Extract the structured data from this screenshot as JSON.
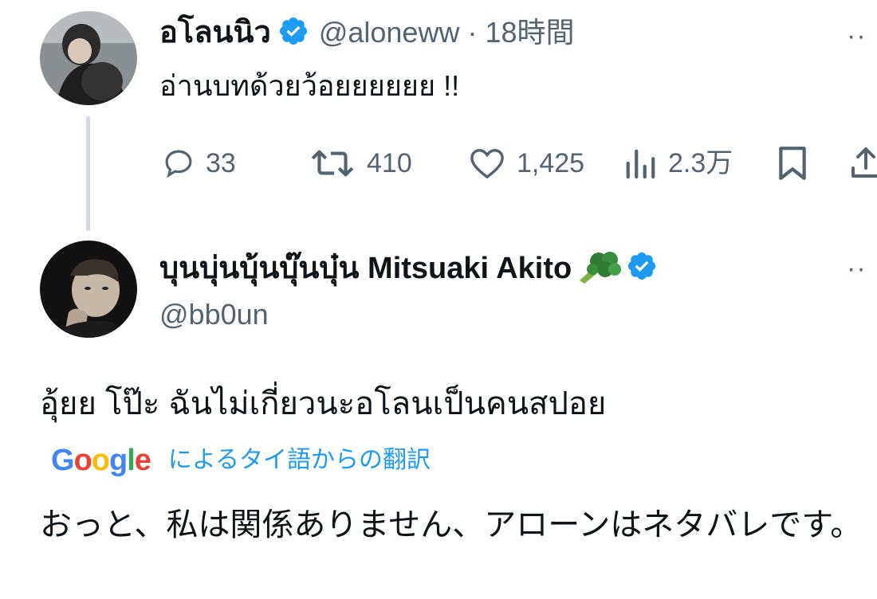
{
  "tweet1": {
    "display_name": "อโลนนิว",
    "handle": "@aloneww",
    "separator": "·",
    "time": "18時間",
    "text": "อ่านบทด้วยว้อยยยยยย !!",
    "actions": {
      "replies": "33",
      "reposts": "410",
      "likes": "1,425",
      "views": "2.3万"
    },
    "more": "··"
  },
  "tweet2": {
    "display_name": "บุนบุ่นบุ้นบุ๊นบุ๋น Mitsuaki Akito",
    "emoji": "🥦",
    "handle": "@bb0un",
    "text": "อุ้ยย โป๊ะ ฉันไม่เกี่ยวนะอโลนเป็นคนสปอย",
    "more": "··",
    "translation": {
      "provider_letters": [
        "G",
        "o",
        "o",
        "g",
        "l",
        "e"
      ],
      "provider_colors": [
        "#4285F4",
        "#EA4335",
        "#FBBC05",
        "#4285F4",
        "#34A853",
        "#EA4335"
      ],
      "label": "によるタイ語からの翻訳",
      "text": "おっと、私は関係ありません、アローンはネタバレです。"
    }
  },
  "colors": {
    "verified": "#1d9bf0",
    "secondary_text": "#536471",
    "thread_line": "#cfd9de"
  }
}
